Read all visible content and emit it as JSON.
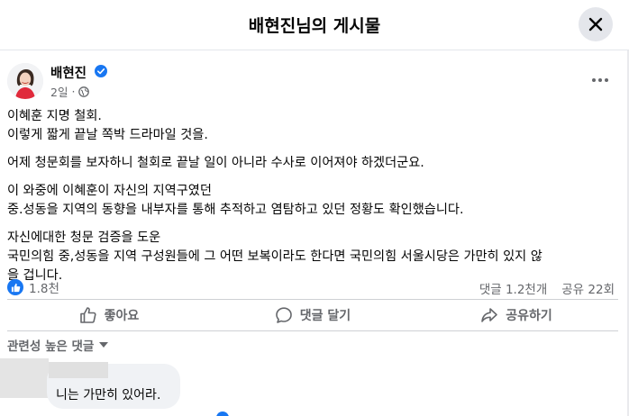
{
  "header": {
    "title": "배현진님의 게시물",
    "close_icon": "close-icon"
  },
  "post": {
    "author": "배현진",
    "verified_icon": "verified-badge-icon",
    "time": "2일",
    "privacy_icon": "globe-icon",
    "more_icon": "more-horizontal-icon",
    "paragraphs": [
      [
        "이혜훈 지명 철회.",
        "이렇게 짧게 끝날 쪽박 드라마일 것을."
      ],
      [
        "어제 청문회를 보자하니 철회로 끝날 일이 아니라 수사로 이어져야 하겠더군요."
      ],
      [
        "이 와중에 이혜훈이 자신의 지역구였던",
        "중.성동을 지역의 동향을 내부자를 통해 추적하고 염탐하고 있던 정황도 확인했습니다."
      ],
      [
        "자신에대한 청문 검증을 도운",
        "국민의힘 중,성동을 지역 구성원들에 그 어떤  보복이라도 한다면 국민의힘 서울시당은 가만히 있지 않",
        "을 겁니다."
      ]
    ]
  },
  "stats": {
    "reaction_icon": "like-icon",
    "reactions": "1.8천",
    "comments": "댓글 1.2천개",
    "shares": "공유 22회"
  },
  "actions": {
    "like": "좋아요",
    "comment": "댓글 달기",
    "share": "공유하기"
  },
  "comments_section": {
    "sort_label": "관련성 높은 댓글",
    "first_comment_text": "니는 가만히 있어라."
  },
  "colors": {
    "brand_blue": "#1877f2",
    "secondary_text": "#65676b",
    "primary_text": "#050505",
    "divider": "#ced0d4",
    "bubble": "#f0f2f5"
  }
}
